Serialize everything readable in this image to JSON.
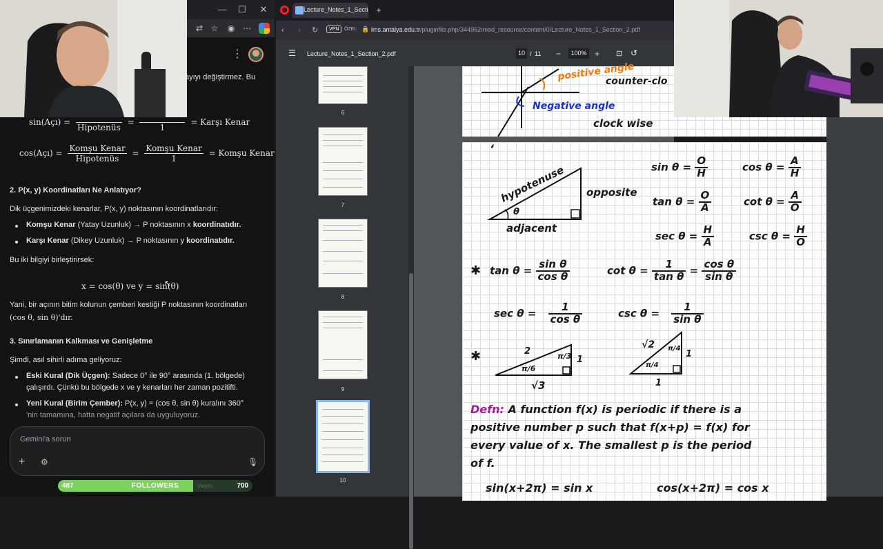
{
  "left_window": {
    "controls": {
      "minimize": "—",
      "maximize": "☐",
      "close": "✕"
    },
    "chat": {
      "truncated_text": "ayıyı değiştirmez. Bu",
      "sin_formula": {
        "lhs": "sin(Açı) =",
        "frac1_den": "Hipotenüs",
        "frac2_den": "1",
        "rhs": "= Karşı Kenar"
      },
      "cos_formula": {
        "lhs": "cos(Açı) =",
        "frac1_num": "Komşu Kenar",
        "frac1_den": "Hipotenüs",
        "frac2_num": "Komşu Kenar",
        "frac2_den": "1",
        "rhs": "= Komşu Kenar"
      },
      "section2_title": "2. P(x, y) Koordinatları Ne Anlatıyor?",
      "section2_intro": "Dik üçgenimizdeki kenarlar, P(x, y) noktasının koordinatlarıdır:",
      "bullet1_bold": "Komşu Kenar",
      "bullet1_rest": "(Yatay Uzunluk) → P noktasının x",
      "bullet1_end": "koordinatıdır.",
      "bullet2_bold": "Karşı Kenar",
      "bullet2_rest": "(Dikey Uzunluk) → P noktasının y",
      "bullet2_end": "koordinatıdır.",
      "combine_text": "Bu iki bilgiyi birleştirirsek:",
      "xy_formula": "x = cos(θ)   ve   y = sin(θ)",
      "meaning_line1": "Yani, bir açının bitim kolunun çemberi kestiği P noktasının koordinatları",
      "meaning_line2": "(cos θ, sin θ)'dır.",
      "section3_title": "3. Sınırlamanın Kalkması ve Genişletme",
      "section3_intro": "Şimdi, asıl sihirli adıma geliyoruz:",
      "b3_bold": "Eski Kural (Dik Üçgen):",
      "b3_rest": "Sadece 0° ile 90° arasında (1. bölgede)",
      "b3_line2": "çalışırdı. Çünkü bu bölgede x ve y kenarları her zaman pozitifti.",
      "b4_bold": "Yeni Kural (Birim Çember):",
      "b4_rest": "P(x, y) = (cos θ, sin θ) kuralını 360°",
      "b4_line2": "'nin tamamına, hatta negatif açılara da uyguluyoruz."
    },
    "composer": {
      "placeholder": "Gemini'a sorun",
      "plus": "+",
      "tools": "⚙",
      "mic": "🎙"
    },
    "followers": {
      "current": "487",
      "label": "FOLLOWERS",
      "goal": "700",
      "progress": 0.696,
      "faint_text": "ulayın."
    }
  },
  "browser": {
    "tab_title": "Lecture_Notes_1_Section_",
    "new_tab": "+",
    "vpn_label": "VPN",
    "private_label": "ÖZEL",
    "url_domain": "lms.antalya.edu.tr",
    "url_path": "/pluginfile.php/344962/mod_resource/content/0/Lecture_Notes_1_Section_2.pdf",
    "pdf": {
      "filename": "Lecture_Notes_1_Section_2.pdf",
      "current_page": "10",
      "page_sep": "/",
      "total_pages": "11",
      "zoom": "100%",
      "zoom_out": "−",
      "zoom_in": "+",
      "thumb_labels": [
        "6",
        "7",
        "8",
        "9",
        "10"
      ]
    }
  },
  "notes": {
    "top_page": {
      "positive_angle": "positive angle",
      "counter_clockwise": "counter-clo",
      "negative_angle": "Negative angle",
      "clockwise": "clock wise"
    },
    "triangle_labels": {
      "hypotenuse": "hypotenuse",
      "opposite": "opposite",
      "adjacent": "adjacent",
      "theta": "θ"
    },
    "ratios": {
      "sin": {
        "lhs": "sin θ =",
        "n": "O",
        "d": "H"
      },
      "cos": {
        "lhs": "cos θ =",
        "n": "A",
        "d": "H"
      },
      "tan": {
        "lhs": "tan θ =",
        "n": "O",
        "d": "A"
      },
      "cot": {
        "lhs": "cot θ =",
        "n": "A",
        "d": "O"
      },
      "sec": {
        "lhs": "sec θ =",
        "n": "H",
        "d": "A"
      },
      "csc": {
        "lhs": "csc θ =",
        "n": "H",
        "d": "O"
      }
    },
    "identities": {
      "star": "✱",
      "tan_lhs": "tan θ =",
      "tan_n": "sin θ",
      "tan_d": "cos θ",
      "cot_lhs": "cot θ =",
      "cot_n1": "1",
      "cot_d1": "tan θ",
      "eq": "=",
      "cot_n2": "cos θ",
      "cot_d2": "sin θ",
      "sec_lhs": "sec θ =",
      "sec_n": "1",
      "sec_d": "cos θ",
      "csc_lhs": "csc θ =",
      "csc_n": "1",
      "csc_d": "sin θ"
    },
    "special_triangles": {
      "t1": {
        "hyp": "2",
        "top_angle": "π/3",
        "side": "1",
        "base_angle": "π/6",
        "base": "√3"
      },
      "t2": {
        "hyp": "√2",
        "top_angle": "π/4",
        "side": "1",
        "base_angle": "π/4",
        "base": "1"
      }
    },
    "definition": {
      "label": "Defn:",
      "line1": "A function f(x) is periodic if there is a",
      "line2": "positive number p such that f(x+p) = f(x) for",
      "line3": "every value of x. The smallest p is the period",
      "line4": "of f.",
      "ex1": "sin(x+2π) = sin x",
      "ex2": "cos(x+2π) = cos x"
    }
  },
  "colors": {
    "orange": "#f07a12",
    "blue": "#1830d0",
    "purple": "#a21aa0",
    "follower_green": "#7bd35d",
    "opera_red": "#ff1b2d"
  }
}
